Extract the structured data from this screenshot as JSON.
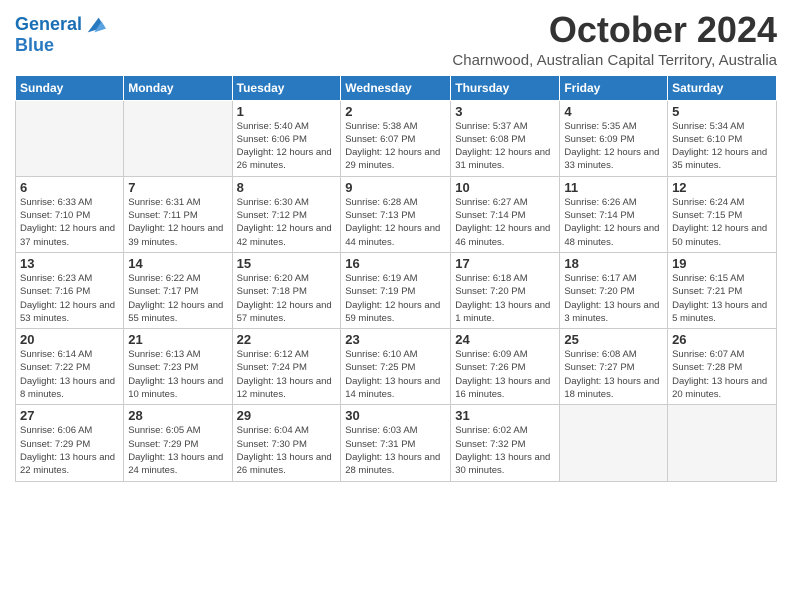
{
  "logo": {
    "line1": "General",
    "line2": "Blue"
  },
  "title": "October 2024",
  "subtitle": "Charnwood, Australian Capital Territory, Australia",
  "days_of_week": [
    "Sunday",
    "Monday",
    "Tuesday",
    "Wednesday",
    "Thursday",
    "Friday",
    "Saturday"
  ],
  "weeks": [
    [
      {
        "day": "",
        "info": ""
      },
      {
        "day": "",
        "info": ""
      },
      {
        "day": "1",
        "info": "Sunrise: 5:40 AM\nSunset: 6:06 PM\nDaylight: 12 hours and 26 minutes."
      },
      {
        "day": "2",
        "info": "Sunrise: 5:38 AM\nSunset: 6:07 PM\nDaylight: 12 hours and 29 minutes."
      },
      {
        "day": "3",
        "info": "Sunrise: 5:37 AM\nSunset: 6:08 PM\nDaylight: 12 hours and 31 minutes."
      },
      {
        "day": "4",
        "info": "Sunrise: 5:35 AM\nSunset: 6:09 PM\nDaylight: 12 hours and 33 minutes."
      },
      {
        "day": "5",
        "info": "Sunrise: 5:34 AM\nSunset: 6:10 PM\nDaylight: 12 hours and 35 minutes."
      }
    ],
    [
      {
        "day": "6",
        "info": "Sunrise: 6:33 AM\nSunset: 7:10 PM\nDaylight: 12 hours and 37 minutes."
      },
      {
        "day": "7",
        "info": "Sunrise: 6:31 AM\nSunset: 7:11 PM\nDaylight: 12 hours and 39 minutes."
      },
      {
        "day": "8",
        "info": "Sunrise: 6:30 AM\nSunset: 7:12 PM\nDaylight: 12 hours and 42 minutes."
      },
      {
        "day": "9",
        "info": "Sunrise: 6:28 AM\nSunset: 7:13 PM\nDaylight: 12 hours and 44 minutes."
      },
      {
        "day": "10",
        "info": "Sunrise: 6:27 AM\nSunset: 7:14 PM\nDaylight: 12 hours and 46 minutes."
      },
      {
        "day": "11",
        "info": "Sunrise: 6:26 AM\nSunset: 7:14 PM\nDaylight: 12 hours and 48 minutes."
      },
      {
        "day": "12",
        "info": "Sunrise: 6:24 AM\nSunset: 7:15 PM\nDaylight: 12 hours and 50 minutes."
      }
    ],
    [
      {
        "day": "13",
        "info": "Sunrise: 6:23 AM\nSunset: 7:16 PM\nDaylight: 12 hours and 53 minutes."
      },
      {
        "day": "14",
        "info": "Sunrise: 6:22 AM\nSunset: 7:17 PM\nDaylight: 12 hours and 55 minutes."
      },
      {
        "day": "15",
        "info": "Sunrise: 6:20 AM\nSunset: 7:18 PM\nDaylight: 12 hours and 57 minutes."
      },
      {
        "day": "16",
        "info": "Sunrise: 6:19 AM\nSunset: 7:19 PM\nDaylight: 12 hours and 59 minutes."
      },
      {
        "day": "17",
        "info": "Sunrise: 6:18 AM\nSunset: 7:20 PM\nDaylight: 13 hours and 1 minute."
      },
      {
        "day": "18",
        "info": "Sunrise: 6:17 AM\nSunset: 7:20 PM\nDaylight: 13 hours and 3 minutes."
      },
      {
        "day": "19",
        "info": "Sunrise: 6:15 AM\nSunset: 7:21 PM\nDaylight: 13 hours and 5 minutes."
      }
    ],
    [
      {
        "day": "20",
        "info": "Sunrise: 6:14 AM\nSunset: 7:22 PM\nDaylight: 13 hours and 8 minutes."
      },
      {
        "day": "21",
        "info": "Sunrise: 6:13 AM\nSunset: 7:23 PM\nDaylight: 13 hours and 10 minutes."
      },
      {
        "day": "22",
        "info": "Sunrise: 6:12 AM\nSunset: 7:24 PM\nDaylight: 13 hours and 12 minutes."
      },
      {
        "day": "23",
        "info": "Sunrise: 6:10 AM\nSunset: 7:25 PM\nDaylight: 13 hours and 14 minutes."
      },
      {
        "day": "24",
        "info": "Sunrise: 6:09 AM\nSunset: 7:26 PM\nDaylight: 13 hours and 16 minutes."
      },
      {
        "day": "25",
        "info": "Sunrise: 6:08 AM\nSunset: 7:27 PM\nDaylight: 13 hours and 18 minutes."
      },
      {
        "day": "26",
        "info": "Sunrise: 6:07 AM\nSunset: 7:28 PM\nDaylight: 13 hours and 20 minutes."
      }
    ],
    [
      {
        "day": "27",
        "info": "Sunrise: 6:06 AM\nSunset: 7:29 PM\nDaylight: 13 hours and 22 minutes."
      },
      {
        "day": "28",
        "info": "Sunrise: 6:05 AM\nSunset: 7:29 PM\nDaylight: 13 hours and 24 minutes."
      },
      {
        "day": "29",
        "info": "Sunrise: 6:04 AM\nSunset: 7:30 PM\nDaylight: 13 hours and 26 minutes."
      },
      {
        "day": "30",
        "info": "Sunrise: 6:03 AM\nSunset: 7:31 PM\nDaylight: 13 hours and 28 minutes."
      },
      {
        "day": "31",
        "info": "Sunrise: 6:02 AM\nSunset: 7:32 PM\nDaylight: 13 hours and 30 minutes."
      },
      {
        "day": "",
        "info": ""
      },
      {
        "day": "",
        "info": ""
      }
    ]
  ]
}
